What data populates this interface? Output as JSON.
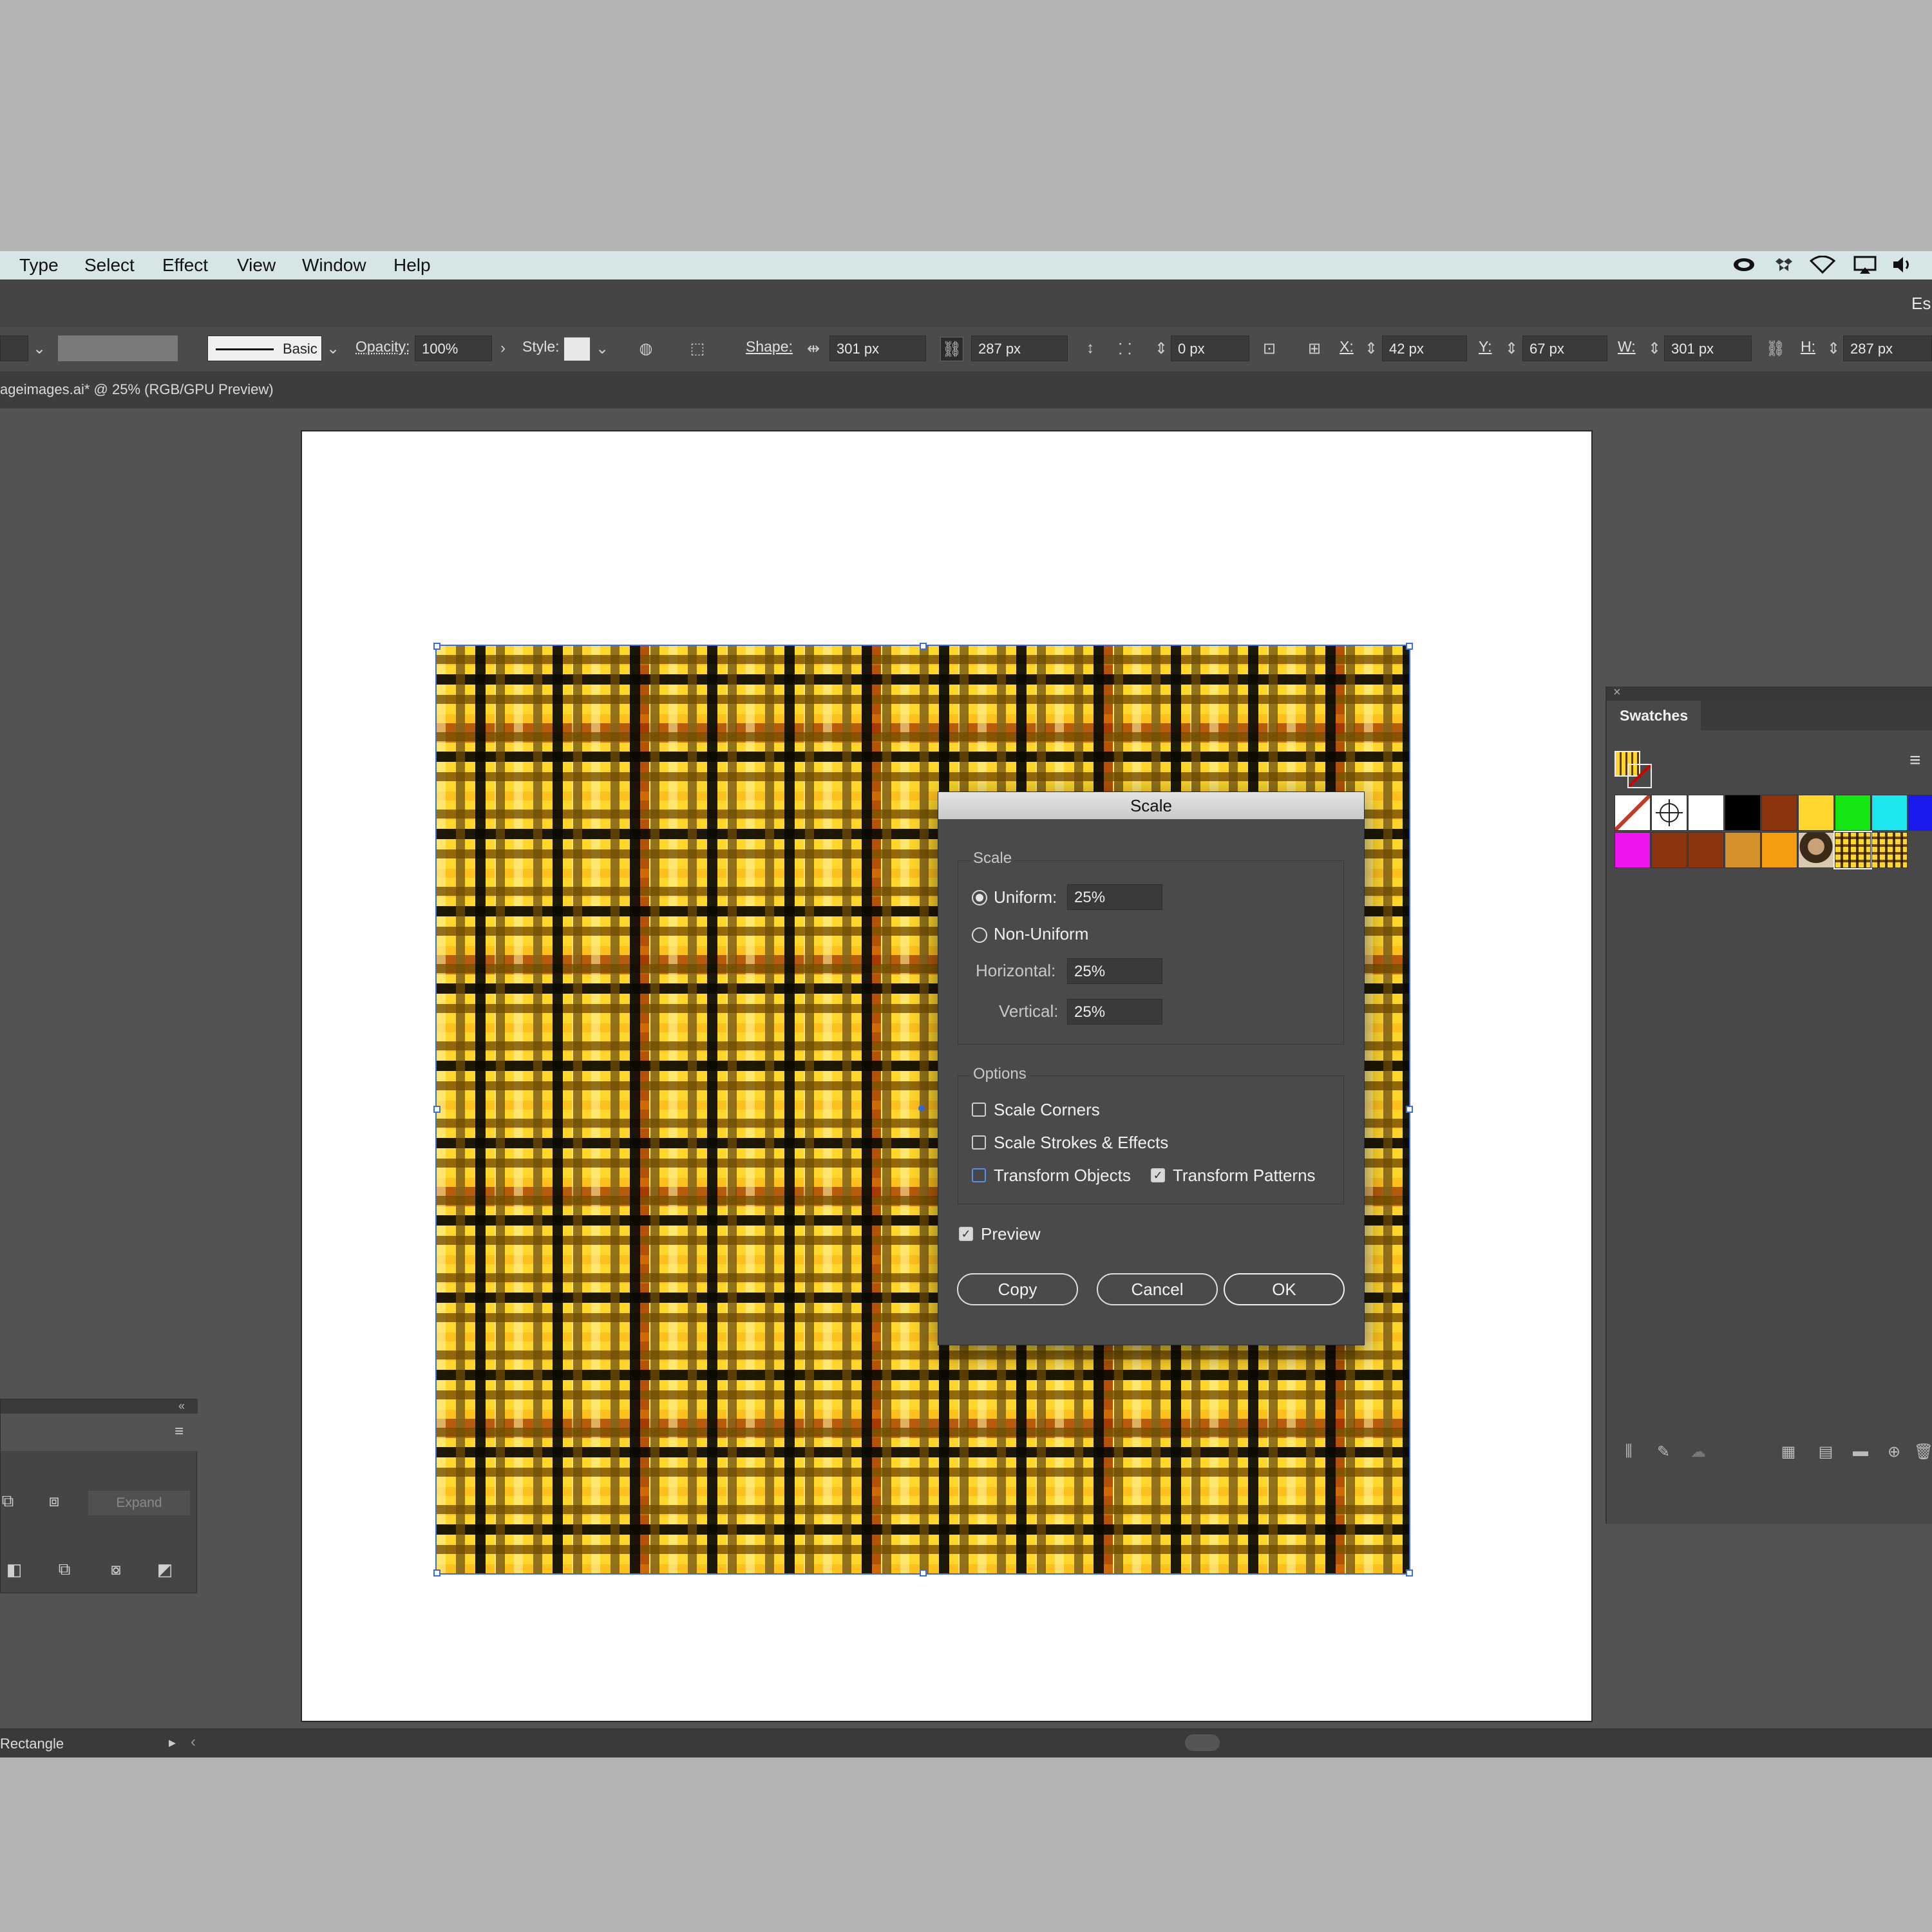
{
  "menubar": {
    "menus": [
      "Type",
      "Select",
      "Effect",
      "View",
      "Window",
      "Help"
    ],
    "system_icons": [
      "creative-cloud-icon",
      "dropbox-icon",
      "wifi-icon",
      "airplay-icon",
      "volume-icon"
    ]
  },
  "ctrlbar": {
    "workspace_label": "Es"
  },
  "toolbar": {
    "stroke_profile": "Basic",
    "opacity_label": "Opacity:",
    "opacity_value": "100%",
    "style_label": "Style:",
    "shape_label": "Shape:",
    "shape_width": "301 px",
    "shape_height": "287 px",
    "corner_value": "0 px",
    "x_label": "X:",
    "x_value": "42 px",
    "y_label": "Y:",
    "y_value": "67 px",
    "w_label": "W:",
    "w_value": "301 px",
    "h_label": "H:",
    "h_value": "287 px"
  },
  "document": {
    "tab_title": "ageimages.ai* @ 25% (RGB/GPU Preview)"
  },
  "left_panel": {
    "expand_label": "Expand"
  },
  "swatches": {
    "tab_label": "Swatches",
    "colors": {
      "row1": [
        "none",
        "registration",
        "#ffffff",
        "#000000",
        "#8c3410",
        "#fed62c",
        "#13e613",
        "#1ee6ef",
        "#1a1aef"
      ],
      "row2": [
        "#ef13ef",
        "#8c3410",
        "#8c3410",
        "#d4902a",
        "#f59c10",
        "image-swatch",
        "plaid-swatch",
        "plaid-swatch-2"
      ]
    }
  },
  "statusbar": {
    "tool_label": "Rectangle"
  },
  "dialog": {
    "title": "Scale",
    "scale_group": "Scale",
    "uniform_label": "Uniform:",
    "uniform_value": "25%",
    "uniform_selected": true,
    "non_uniform_label": "Non-Uniform",
    "horizontal_label": "Horizontal:",
    "horizontal_value": "25%",
    "vertical_label": "Vertical:",
    "vertical_value": "25%",
    "options_group": "Options",
    "scale_corners_label": "Scale Corners",
    "scale_corners_checked": false,
    "scale_strokes_label": "Scale Strokes & Effects",
    "scale_strokes_checked": false,
    "transform_objects_label": "Transform Objects",
    "transform_objects_checked": false,
    "transform_patterns_label": "Transform Patterns",
    "transform_patterns_checked": true,
    "preview_label": "Preview",
    "preview_checked": true,
    "copy_label": "Copy",
    "cancel_label": "Cancel",
    "ok_label": "OK"
  }
}
